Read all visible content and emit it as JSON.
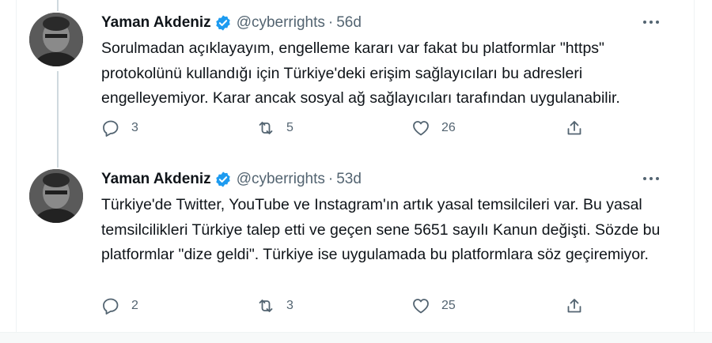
{
  "tweets": [
    {
      "author": {
        "display_name": "Yaman Akdeniz",
        "handle": "@cyberrights",
        "verified": true
      },
      "separator": "·",
      "time": "56d",
      "text": "Sorulmadan açıklayayım, engelleme kararı var fakat bu platformlar \"https\" protokolünü kullandığı için Türkiye'deki erişim sağlayıcıları bu adresleri engelleyemiyor. Karar ancak sosyal ağ sağlayıcıları tarafından uygulanabilir.",
      "replies": "3",
      "retweets": "5",
      "likes": "26",
      "icons": {
        "reply": "reply-icon",
        "retweet": "retweet-icon",
        "like": "heart-icon",
        "share": "share-icon",
        "more": "more-icon"
      }
    },
    {
      "author": {
        "display_name": "Yaman Akdeniz",
        "handle": "@cyberrights",
        "verified": true
      },
      "separator": "·",
      "time": "53d",
      "text": "Türkiye'de Twitter, YouTube ve Instagram'ın artık yasal temsilcileri var. Bu yasal temsilcilikleri Türkiye talep etti ve geçen sene 5651 sayılı Kanun değişti. Sözde bu platformlar \"dize geldi\". Türkiye ise uygulamada bu platformlara söz geçiremiyor.",
      "replies": "2",
      "retweets": "3",
      "likes": "25",
      "icons": {
        "reply": "reply-icon",
        "retweet": "retweet-icon",
        "like": "heart-icon",
        "share": "share-icon",
        "more": "more-icon"
      }
    }
  ],
  "colors": {
    "verified_badge": "#1d9bf0",
    "secondary_text": "#536471",
    "primary_text": "#0f1419",
    "thread_line": "#cfd9de"
  }
}
